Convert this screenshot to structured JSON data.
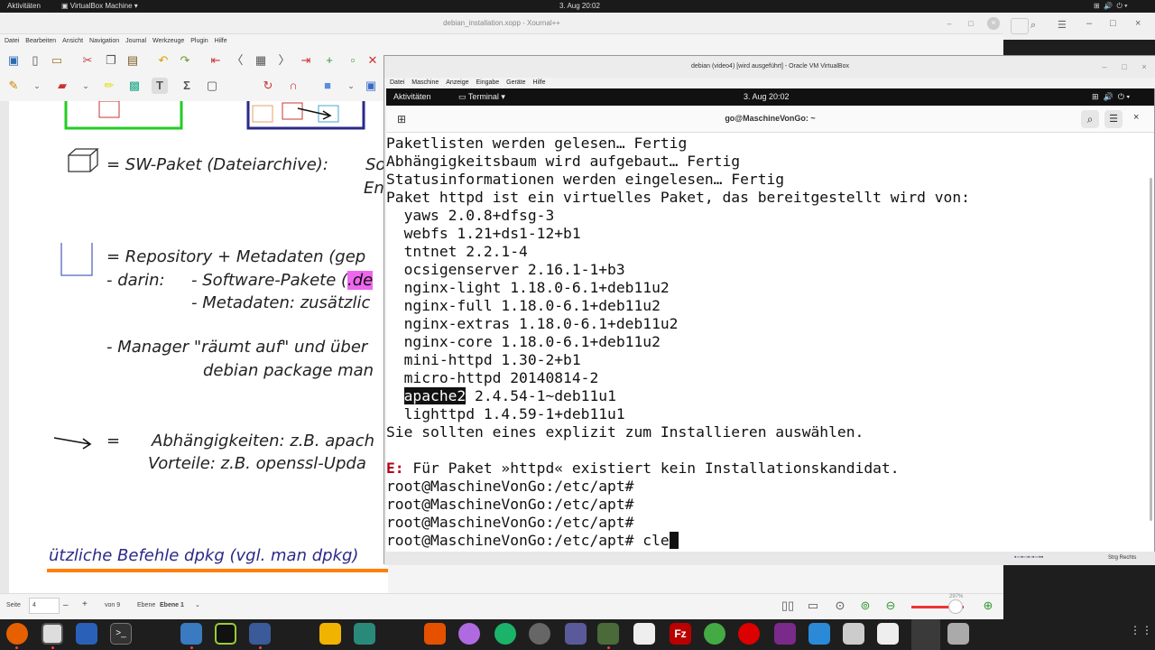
{
  "host": {
    "activities": "Aktivitäten",
    "app_name": "VirtualBox Machine",
    "clock": "3. Aug 20:02"
  },
  "xournal": {
    "title": "debian_installation.xopp - Xournal++",
    "menu": [
      "Datei",
      "Bearbeiten",
      "Ansicht",
      "Navigation",
      "Journal",
      "Werkzeuge",
      "Plugin",
      "Hilfe"
    ],
    "notes": {
      "line1": "= SW-Paket (Dateiarchive):",
      "line1b": "So",
      "line1c": "En",
      "line2": "= Repository + Metadaten  (gep",
      "line3a": "- darin:",
      "line3b": "- Software-Pakete (",
      "line3c": ".de",
      "line4": "- Metadaten: zusätzlic",
      "line5": "- Manager \"räumt auf\" und über",
      "line6": "debian package man",
      "line7a": "=",
      "line7b": "Abhängigkeiten: z.B. apach",
      "line8": "Vorteile:  z.B. openssl-Upda",
      "line9": "ützliche Befehle dpkg (vgl. man dpkg)"
    },
    "status": {
      "page_label": "Seite",
      "page_value": "4",
      "page_of": "von 9",
      "layer_label": "Ebene",
      "layer_value": "Ebene 1",
      "zoom": "297%"
    }
  },
  "vm": {
    "title": "debian (video4) [wird ausgeführt] - Oracle VM VirtualBox",
    "menu": [
      "Datei",
      "Maschine",
      "Anzeige",
      "Eingabe",
      "Geräte",
      "Hilfe"
    ],
    "guest": {
      "activities": "Aktivitäten",
      "terminal": "Terminal",
      "clock": "3. Aug  20:02"
    },
    "terminal_title": "go@MaschineVonGo: ~",
    "host_key": "Strg Rechts"
  },
  "terminal": {
    "lines": [
      "Paketlisten werden gelesen… Fertig",
      "Abhängigkeitsbaum wird aufgebaut… Fertig",
      "Statusinformationen werden eingelesen… Fertig",
      "Paket httpd ist ein virtuelles Paket, das bereitgestellt wird von:",
      "  yaws 2.0.8+dfsg-3",
      "  webfs 1.21+ds1-12+b1",
      "  tntnet 2.2.1-4",
      "  ocsigenserver 2.16.1-1+b3",
      "  nginx-light 1.18.0-6.1+deb11u2",
      "  nginx-full 1.18.0-6.1+deb11u2",
      "  nginx-extras 1.18.0-6.1+deb11u2",
      "  nginx-core 1.18.0-6.1+deb11u2",
      "  mini-httpd 1.30-2+b1",
      "  micro-httpd 20140814-2"
    ],
    "highlight_pkg": "apache2",
    "highlight_rest": " 2.4.54-1~deb11u1",
    "lighttpd": "  lighttpd 1.4.59-1+deb11u1",
    "choose": "Sie sollten eines explizit zum Installieren auswählen.",
    "err_prefix": "E:",
    "err_msg": " Für Paket »httpd« existiert kein Installationskandidat.",
    "prompts": [
      "root@MaschineVonGo:/etc/apt#",
      "root@MaschineVonGo:/etc/apt#",
      "root@MaschineVonGo:/etc/apt#"
    ],
    "last_prompt": "root@MaschineVonGo:/etc/apt# ",
    "typed": "cle"
  },
  "colors": {
    "error_red": "#b3001b",
    "note_blue": "#2a2a8a",
    "green_box": "#22cc22",
    "orange_underline": "#ff7f00"
  }
}
